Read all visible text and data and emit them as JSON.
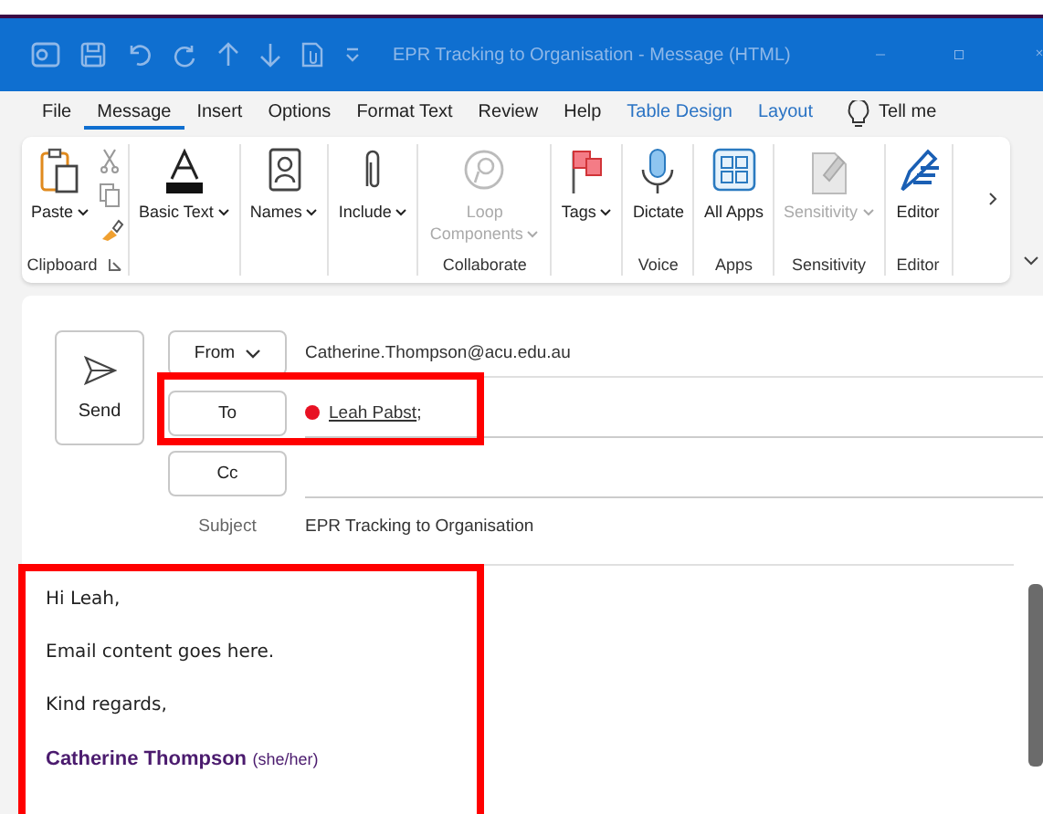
{
  "title_bar": {
    "title": "EPR Tracking to Organisation  -  Message (HTML)"
  },
  "tabs": [
    {
      "label": "File",
      "selected": false,
      "contextual": false
    },
    {
      "label": "Message",
      "selected": true,
      "contextual": false
    },
    {
      "label": "Insert",
      "selected": false,
      "contextual": false
    },
    {
      "label": "Options",
      "selected": false,
      "contextual": false
    },
    {
      "label": "Format Text",
      "selected": false,
      "contextual": false
    },
    {
      "label": "Review",
      "selected": false,
      "contextual": false
    },
    {
      "label": "Help",
      "selected": false,
      "contextual": false
    },
    {
      "label": "Table Design",
      "selected": false,
      "contextual": true
    },
    {
      "label": "Layout",
      "selected": false,
      "contextual": true
    }
  ],
  "tell_me": "Tell me",
  "ribbon": {
    "groups": [
      {
        "label": "Clipboard",
        "buttons": [
          {
            "label": "Paste",
            "dropdown": true,
            "disabled": false
          }
        ]
      },
      {
        "buttons": [
          {
            "label": "Basic Text",
            "dropdown": true,
            "disabled": false
          }
        ]
      },
      {
        "buttons": [
          {
            "label": "Names",
            "dropdown": true,
            "disabled": false
          }
        ]
      },
      {
        "buttons": [
          {
            "label": "Include",
            "dropdown": true,
            "disabled": false
          }
        ]
      },
      {
        "label": "Collaborate",
        "buttons": [
          {
            "label": "Loop Components",
            "dropdown": true,
            "disabled": true
          }
        ]
      },
      {
        "buttons": [
          {
            "label": "Tags",
            "dropdown": true,
            "disabled": false
          }
        ]
      },
      {
        "label": "Voice",
        "buttons": [
          {
            "label": "Dictate",
            "dropdown": false,
            "disabled": false
          }
        ]
      },
      {
        "label": "Apps",
        "buttons": [
          {
            "label": "All Apps",
            "dropdown": false,
            "disabled": false
          }
        ]
      },
      {
        "label": "Sensitivity",
        "buttons": [
          {
            "label": "Sensitivity",
            "dropdown": true,
            "disabled": true
          }
        ]
      },
      {
        "label": "Editor",
        "buttons": [
          {
            "label": "Editor",
            "dropdown": false,
            "disabled": false
          }
        ]
      }
    ]
  },
  "compose": {
    "send": "Send",
    "from": {
      "label": "From",
      "value": "Catherine.Thompson@acu.edu.au"
    },
    "to": {
      "label": "To",
      "recipients": [
        {
          "name": "Leah Pabst",
          "separator": ";",
          "color": "#e81123"
        }
      ]
    },
    "cc": {
      "label": "Cc"
    },
    "subject": {
      "label": "Subject",
      "value": "EPR Tracking to Organisation"
    }
  },
  "body": {
    "paragraphs": [
      "Hi Leah,",
      "Email content goes here.",
      "Kind regards,"
    ],
    "signature": {
      "name": "Catherine Thompson",
      "pronouns": "(she/her)"
    }
  }
}
